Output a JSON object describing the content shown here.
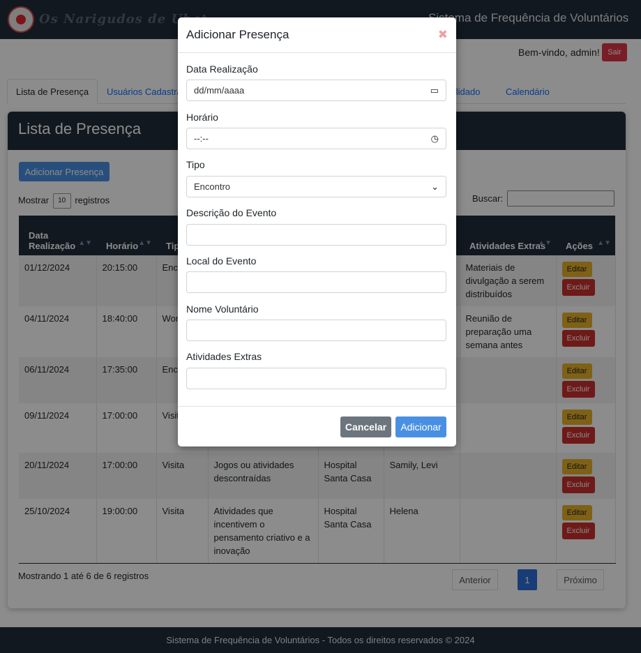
{
  "header": {
    "logo_text": "Os Narigudos de Ubat",
    "title": "Sistema de Frequência de Voluntários"
  },
  "user": {
    "welcome": "Bem-vindo, admin!",
    "logout_label": "Sair"
  },
  "tabs": [
    {
      "label": "Lista de Presença",
      "active": true
    },
    {
      "label": "Usuários Cadastra"
    },
    {
      "label": "solidado"
    },
    {
      "label": "Calendário"
    }
  ],
  "card": {
    "title": "Lista de Presença",
    "add_button": "Adicionar Presença",
    "show_prefix": "Mostrar",
    "show_value": "10",
    "show_suffix": "registros",
    "search_label": "Buscar:"
  },
  "table": {
    "headers": [
      "Data Realização",
      "Horário",
      "Tip",
      "",
      "",
      "",
      "Atividades Extras",
      "Ações"
    ],
    "rows": [
      {
        "date": "01/12/2024",
        "time": "20:15:00",
        "type": "Enc",
        "desc": "",
        "local": "",
        "names": "",
        "extras": "Materiais de divulgação a serem distribuídos"
      },
      {
        "date": "04/11/2024",
        "time": "18:40:00",
        "type": "Wor",
        "desc": "",
        "local": "",
        "names": "",
        "extras": "Reunião de preparação uma semana antes"
      },
      {
        "date": "06/11/2024",
        "time": "17:35:00",
        "type": "Enc",
        "desc": "",
        "local": "",
        "names": "",
        "extras": ""
      },
      {
        "date": "09/11/2024",
        "time": "17:00:00",
        "type": "Visit",
        "desc": "",
        "local": "",
        "names": "",
        "extras": ""
      },
      {
        "date": "20/11/2024",
        "time": "17:00:00",
        "type": "Visita",
        "desc": "Jogos ou atividades descontraídas",
        "local": "Hospital Santa Casa",
        "names": "Samily, Levi",
        "extras": ""
      },
      {
        "date": "25/10/2024",
        "time": "19:00:00",
        "type": "Visita",
        "desc": "Atividades que incentivem o pensamento criativo e a inovação",
        "local": "Hospital Santa Casa",
        "names": "Helena",
        "extras": ""
      }
    ],
    "edit_label": "Editar",
    "delete_label": "Excluir"
  },
  "pagination": {
    "info": "Mostrando 1 até 6 de 6 registros",
    "prev": "Anterior",
    "current": "1",
    "next": "Próximo"
  },
  "footer": {
    "text": "Sistema de Frequência de Voluntários - Todos os direitos reservados © 2024"
  },
  "modal": {
    "title": "Adicionar Presença",
    "close_glyph": "✖",
    "date_label": "Data Realização",
    "date_value": "dd/mm/aaaa",
    "time_label": "Horário",
    "time_value": "--:--",
    "type_label": "Tipo",
    "type_value": "Encontro",
    "desc_label": "Descrição do Evento",
    "local_label": "Local do Evento",
    "volunteer_label": "Nome Voluntário",
    "extras_label": "Atividades Extras",
    "cancel_label": "Cancelar",
    "submit_label": "Adicionar"
  },
  "colors": {
    "navy": "#222c3b",
    "primary": "#4a90e2",
    "danger": "#dc3545",
    "warning": "#e6b12a"
  }
}
